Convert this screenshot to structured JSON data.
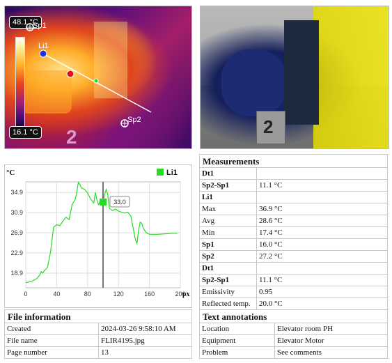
{
  "thermal": {
    "max_label": "48.1 °C",
    "min_label": "16.1 °C",
    "spot1_label": "Sp1",
    "spot2_label": "Sp2",
    "line_label": "Li1",
    "marker_digit": "2"
  },
  "visual": {
    "marker_digit": "2"
  },
  "chart": {
    "unit": "°C",
    "legend": "Li1",
    "x_unit": "px",
    "cursor_value": "33.0"
  },
  "chart_data": {
    "type": "line",
    "title": "",
    "xlabel": "px",
    "ylabel": "°C",
    "xlim": [
      0,
      200
    ],
    "ylim": [
      16.0,
      37.0
    ],
    "xticks": [
      "0",
      "40",
      "80",
      "120",
      "160",
      "200"
    ],
    "yticks": [
      "34.9",
      "30.9",
      "26.9",
      "22.9",
      "18.9"
    ],
    "grid": true,
    "legend_position": "top-right",
    "cursor_x": 100,
    "cursor_y": 33.0,
    "series": [
      {
        "name": "Li1",
        "color": "#22dd22",
        "x": [
          0,
          8,
          14,
          18,
          20,
          22,
          24,
          28,
          32,
          36,
          40,
          44,
          48,
          52,
          56,
          60,
          64,
          66,
          68,
          70,
          72,
          76,
          80,
          84,
          88,
          90,
          92,
          94,
          96,
          98,
          100,
          102,
          104,
          106,
          108,
          112,
          116,
          120,
          124,
          128,
          132,
          136,
          140,
          142,
          144,
          146,
          148,
          150,
          152,
          156,
          160,
          170,
          180,
          190,
          196
        ],
        "y": [
          17.0,
          17.3,
          17.8,
          18.5,
          19.2,
          18.9,
          19.4,
          20.0,
          23.0,
          28.0,
          28.5,
          28.3,
          29.2,
          30.0,
          29.5,
          32.5,
          33.5,
          35.0,
          36.9,
          36.5,
          35.8,
          35.5,
          34.8,
          33.6,
          32.8,
          34.9,
          33.5,
          32.5,
          33.0,
          33.0,
          33.0,
          34.5,
          35.5,
          34.6,
          31.8,
          31.3,
          31.6,
          31.2,
          31.0,
          30.8,
          31.0,
          30.2,
          27.0,
          25.5,
          24.8,
          27.5,
          29.0,
          28.8,
          27.8,
          26.9,
          26.6,
          26.6,
          26.7,
          26.8,
          26.8
        ]
      }
    ]
  },
  "measurements": {
    "title": "Measurements",
    "rows": [
      {
        "label": "Dt1",
        "value": "",
        "bold": true
      },
      {
        "label": "Sp2-Sp1",
        "value": "11.1 °C",
        "bold": true
      },
      {
        "label": "Li1",
        "value": "",
        "bold": true
      },
      {
        "label": "Max",
        "value": "36.9 °C",
        "bold": false
      },
      {
        "label": "Avg",
        "value": "28.6 °C",
        "bold": false
      },
      {
        "label": "Min",
        "value": "17.4 °C",
        "bold": false
      },
      {
        "label": "Sp1",
        "value": "16.0 °C",
        "bold": true
      },
      {
        "label": "Sp2",
        "value": "27.2 °C",
        "bold": true
      },
      {
        "label": "Dt1",
        "value": "",
        "bold": true
      },
      {
        "label": "Sp2-Sp1",
        "value": "11.1 °C",
        "bold": true
      },
      {
        "label": "Emissivity",
        "value": "0.95",
        "bold": false
      },
      {
        "label": "Reflected temp.",
        "value": "20.0 °C",
        "bold": false
      }
    ]
  },
  "file_info": {
    "title": "File information",
    "rows": [
      {
        "label": "Created",
        "value": "2024-03-26 9:58:10 AM"
      },
      {
        "label": "File name",
        "value": "FLIR4195.jpg"
      },
      {
        "label": "Page number",
        "value": "13"
      }
    ]
  },
  "text_annotations": {
    "title": "Text annotations",
    "rows": [
      {
        "label": "Location",
        "value": "Elevator room PH"
      },
      {
        "label": "Equipment",
        "value": "Elevator Motor"
      },
      {
        "label": "Problem",
        "value": "See comments"
      }
    ]
  }
}
